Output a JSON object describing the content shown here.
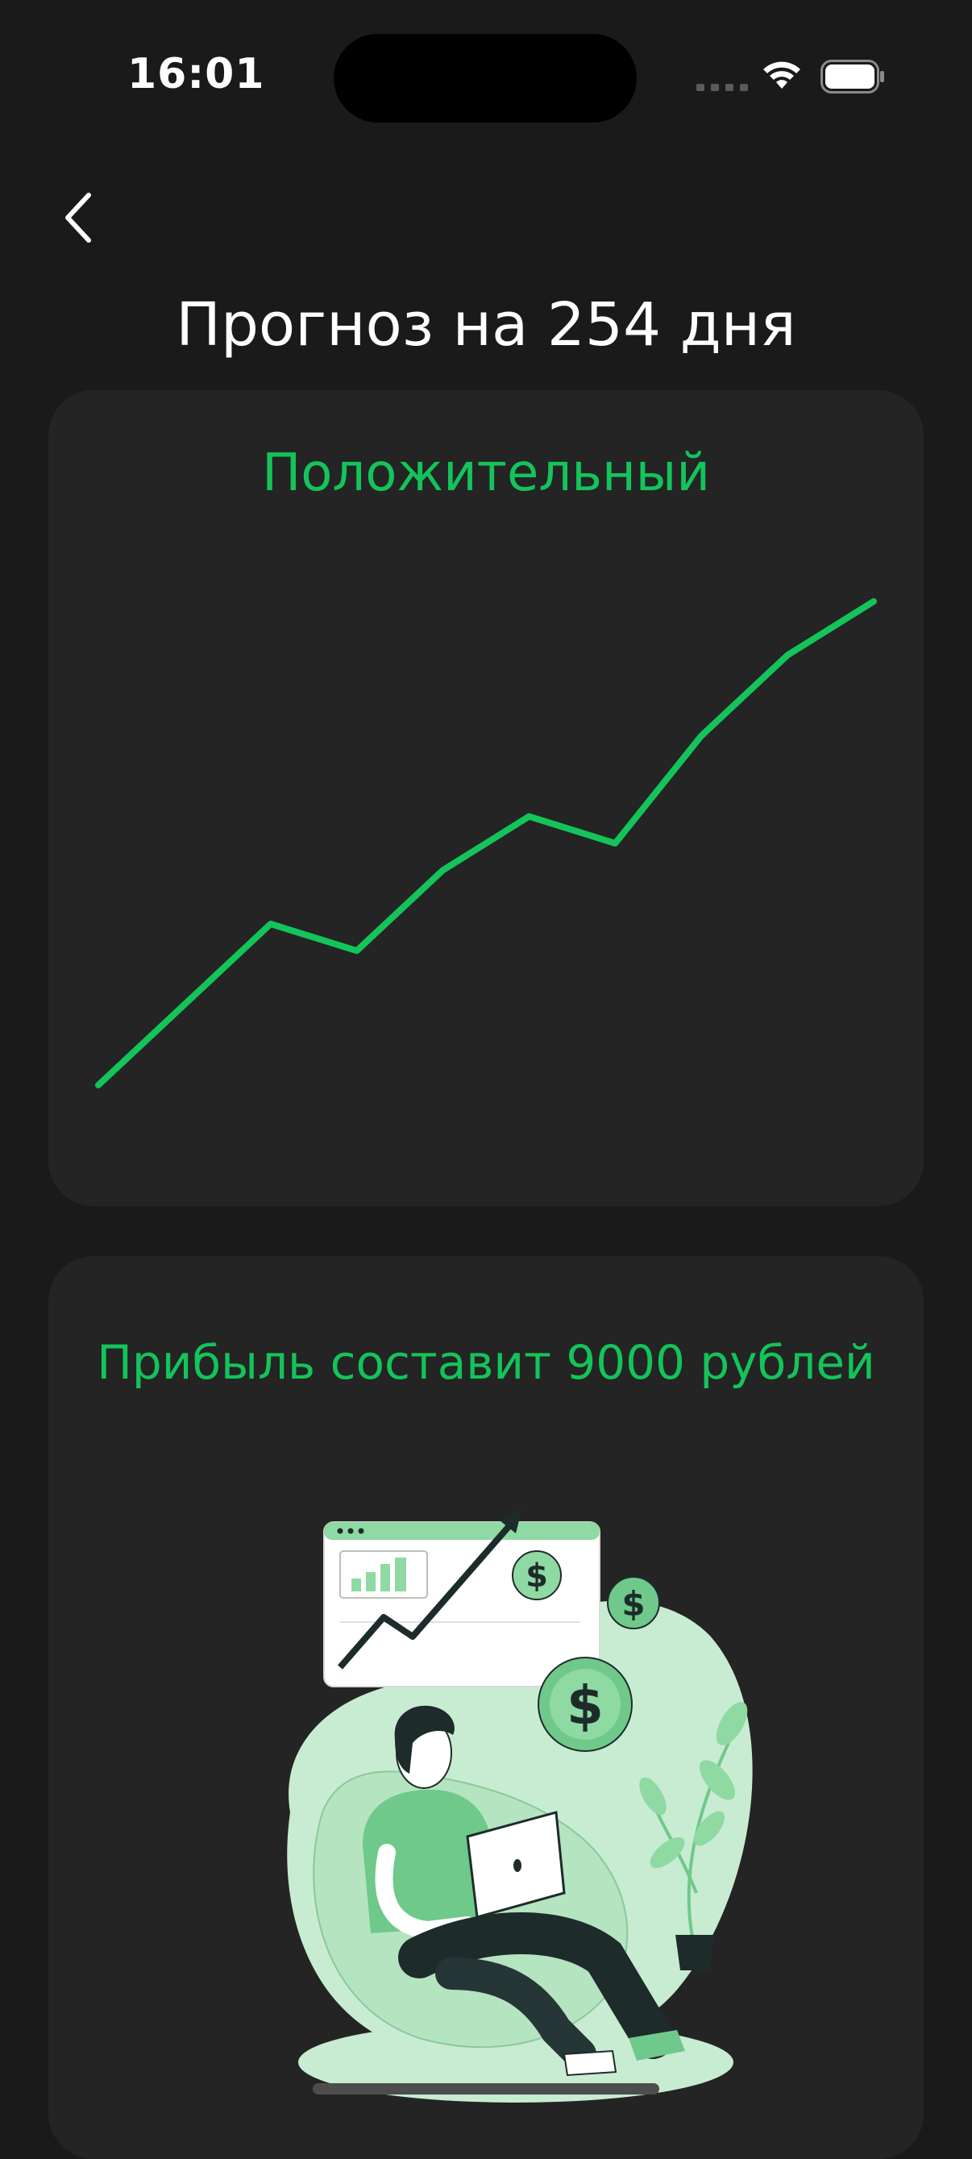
{
  "status_bar": {
    "time": "16:01"
  },
  "header": {
    "back_icon": "chevron-left-icon",
    "title": "Прогноз на 254 дня"
  },
  "forecast_card": {
    "label": "Положительный",
    "line_color": "#13c45a"
  },
  "chart_data": {
    "type": "line",
    "title": "",
    "xlabel": "",
    "ylabel": "",
    "grid": false,
    "series": [
      {
        "color": "#13c45a",
        "values": [
          0,
          30,
          60,
          50,
          80,
          100,
          90,
          130,
          160,
          180
        ]
      }
    ],
    "ylim": [
      0,
      180
    ]
  },
  "profit_card": {
    "label": "Прибыль составит 9000 рублей",
    "illustration": "person-with-laptop-growth-illustration"
  },
  "colors": {
    "background": "#1a1a1a",
    "card": "#242424",
    "accent": "#13c45a"
  }
}
